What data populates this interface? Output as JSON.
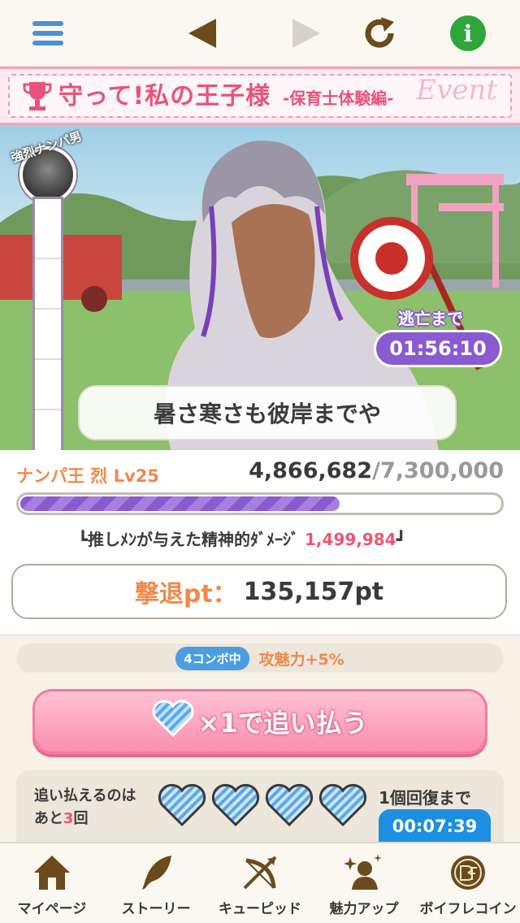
{
  "topbar": {
    "menu_icon": "hamburger-icon",
    "back_icon": "triangle-left-icon",
    "forward_icon": "triangle-right-icon",
    "reload_icon": "reload-icon",
    "info_icon": "info-icon",
    "info_glyph": "i"
  },
  "banner": {
    "title": "守って!私の王子様",
    "subtitle": "-保育士体験編-",
    "event_word": "Event",
    "trophy_icon": "trophy-icon"
  },
  "hero": {
    "gauge_tag": "強烈ナンパ男",
    "gauge_fraction": 0.2,
    "timer_label": "逃亡まで",
    "timer_value": "01:56:10",
    "speech": "暑さ寒さも彼岸までや"
  },
  "status": {
    "enemy_name": "ナンパ王 烈 Lv25",
    "hp_current": "4,866,682",
    "hp_max": "/7,300,000",
    "hp_fraction": 0.6667,
    "damage_label": "┗推しﾒﾝが与えた精神的ﾀﾞﾒｰｼﾞ",
    "damage_value": "1,499,984",
    "damage_end": "┛",
    "pt_label": "撃退pt：",
    "pt_value": "135,157pt"
  },
  "combo": {
    "badge": "4コンボ中",
    "text": "攻魅力+5%"
  },
  "attack": {
    "label": "×1で追い払う",
    "heart_icon": "heart-icon"
  },
  "remain": {
    "line1": "追い払えるのは",
    "line2_pre": "あと",
    "line2_num": "3",
    "line2_post": "回",
    "hearts_count": 4,
    "recover_label": "1個回復まで",
    "recover_timer": "00:07:39"
  },
  "nav": {
    "items": [
      {
        "label": "マイページ",
        "icon": "home-icon"
      },
      {
        "label": "ストーリー",
        "icon": "quill-icon"
      },
      {
        "label": "キューピッド",
        "icon": "bow-arrow-icon"
      },
      {
        "label": "魅力アップ",
        "icon": "person-sparkle-icon"
      },
      {
        "label": "ボイフレコイン",
        "icon": "coin-icon"
      }
    ]
  },
  "colors": {
    "accent_purple": "#8a5ad0",
    "accent_pink": "#e8537c",
    "accent_orange": "#f08a4b",
    "accent_blue": "#1d8fe0"
  }
}
